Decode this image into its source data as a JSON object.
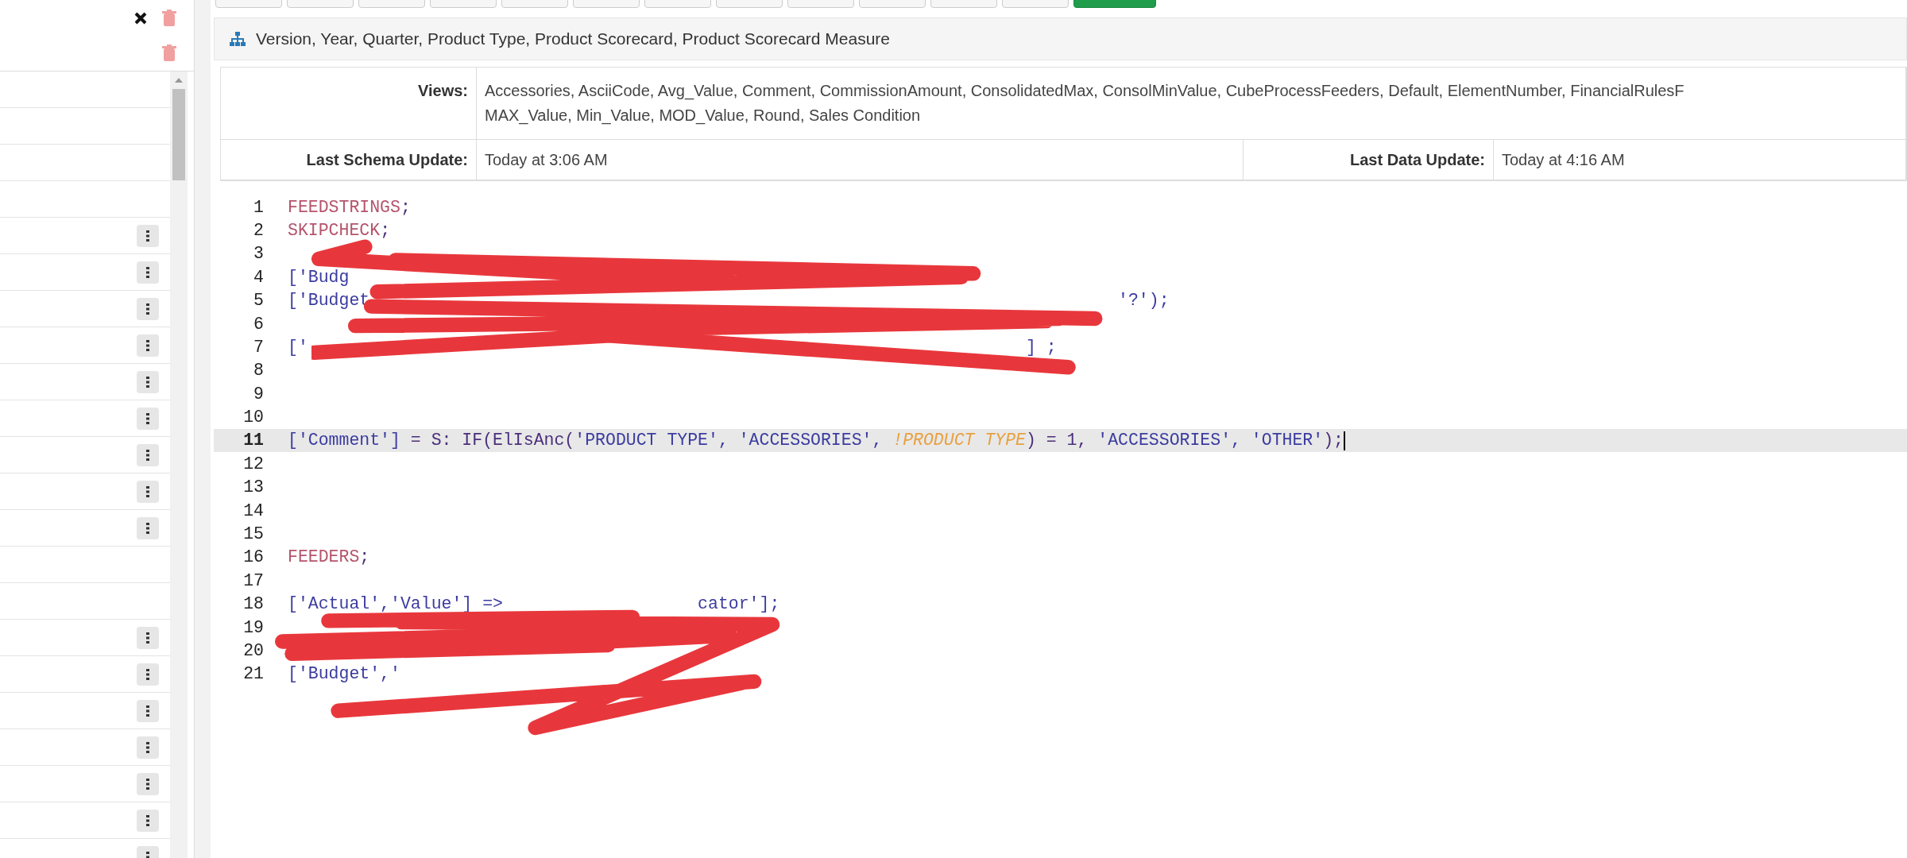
{
  "left_panel": {
    "header_icons": [
      {
        "kind": "close"
      },
      {
        "kind": "delete"
      }
    ],
    "second_row_icons": [
      {
        "kind": "delete"
      }
    ],
    "rows": [
      {
        "menu": false
      },
      {
        "menu": false
      },
      {
        "menu": false
      },
      {
        "menu": false
      },
      {
        "menu": true
      },
      {
        "menu": true
      },
      {
        "menu": true
      },
      {
        "menu": true
      },
      {
        "menu": true
      },
      {
        "menu": true
      },
      {
        "menu": true
      },
      {
        "menu": true
      },
      {
        "menu": true
      },
      {
        "menu": false
      },
      {
        "menu": false
      },
      {
        "menu": true
      },
      {
        "menu": true
      },
      {
        "menu": true
      },
      {
        "menu": true
      },
      {
        "menu": true
      },
      {
        "menu": true
      },
      {
        "menu": true
      }
    ]
  },
  "toolbar": {
    "buttons": [
      {
        "kind": "default"
      },
      {
        "kind": "default"
      },
      {
        "kind": "default"
      },
      {
        "kind": "default"
      },
      {
        "kind": "default"
      },
      {
        "kind": "default"
      },
      {
        "kind": "default"
      },
      {
        "kind": "default"
      },
      {
        "kind": "default"
      },
      {
        "kind": "default"
      },
      {
        "kind": "default"
      },
      {
        "kind": "default"
      },
      {
        "kind": "success"
      }
    ]
  },
  "cube": {
    "dimensions": "Version, Year, Quarter, Product Type, Product Scorecard, Product Scorecard Measure",
    "views_label": "Views:",
    "views_lines": [
      "Accessories, AsciiCode, Avg_Value, Comment, CommissionAmount, ConsolidatedMax, ConsolMinValue, CubeProcessFeeders, Default, ElementNumber, FinancialRulesF",
      "MAX_Value, Min_Value, MOD_Value, Round, Sales Condition"
    ],
    "schema_label": "Last Schema Update:",
    "schema_value": "Today at 3:06 AM",
    "data_label": "Last Data Update:",
    "data_value": "Today at 4:16 AM"
  },
  "editor": {
    "lines": [
      {
        "number": "1",
        "current": false,
        "tokens": [
          {
            "kind": "keyword",
            "text": "FEEDSTRINGS"
          },
          {
            "kind": "plain",
            "text": ";"
          }
        ]
      },
      {
        "number": "2",
        "current": false,
        "tokens": [
          {
            "kind": "keyword",
            "text": "SKIPCHECK"
          },
          {
            "kind": "plain",
            "text": ";"
          }
        ]
      },
      {
        "number": "3",
        "current": false
      },
      {
        "number": "4",
        "current": false,
        "tokens": [
          {
            "kind": "string",
            "text": "['Budg"
          }
        ]
      },
      {
        "number": "5",
        "current": false,
        "tokens": [
          {
            "kind": "string",
            "text": "['Budget"
          },
          {
            "kind": "gap"
          },
          {
            "kind": "string",
            "text": "'?');"
          }
        ]
      },
      {
        "number": "6",
        "current": false
      },
      {
        "number": "7",
        "current": false,
        "tokens": [
          {
            "kind": "string",
            "text": "['"
          },
          {
            "kind": "gap"
          },
          {
            "kind": "string",
            "text": "] ;"
          }
        ]
      },
      {
        "number": "8",
        "current": false
      },
      {
        "number": "9",
        "current": false
      },
      {
        "number": "10",
        "current": false
      },
      {
        "number": "11",
        "current": true,
        "tokens": [
          {
            "kind": "string",
            "text": "['Comment']"
          },
          {
            "kind": "plain",
            "text": " = S: IF(ElIsAnc("
          },
          {
            "kind": "string",
            "text": "'PRODUCT TYPE', 'ACCESSORIES', "
          },
          {
            "kind": "dimref",
            "text": "!PRODUCT TYPE"
          },
          {
            "kind": "plain",
            "text": ") = 1, "
          },
          {
            "kind": "string",
            "text": "'ACCESSORIES', 'OTHER'"
          },
          {
            "kind": "plain",
            "text": ");"
          }
        ]
      },
      {
        "number": "12",
        "current": false
      },
      {
        "number": "13",
        "current": false
      },
      {
        "number": "14",
        "current": false
      },
      {
        "number": "15",
        "current": false
      },
      {
        "number": "16",
        "current": false,
        "tokens": [
          {
            "kind": "keyword",
            "text": "FEEDERS"
          },
          {
            "kind": "plain",
            "text": ";"
          }
        ]
      },
      {
        "number": "17",
        "current": false
      },
      {
        "number": "18",
        "current": false,
        "tokens": [
          {
            "kind": "string",
            "text": "['Actual','Value'] =>"
          },
          {
            "kind": "gap"
          },
          {
            "kind": "string",
            "text": "cator'];"
          }
        ]
      },
      {
        "number": "19",
        "current": false
      },
      {
        "number": "20",
        "current": false
      },
      {
        "number": "21",
        "current": false,
        "tokens": [
          {
            "kind": "string",
            "text": "['Budget','"
          }
        ]
      }
    ]
  }
}
